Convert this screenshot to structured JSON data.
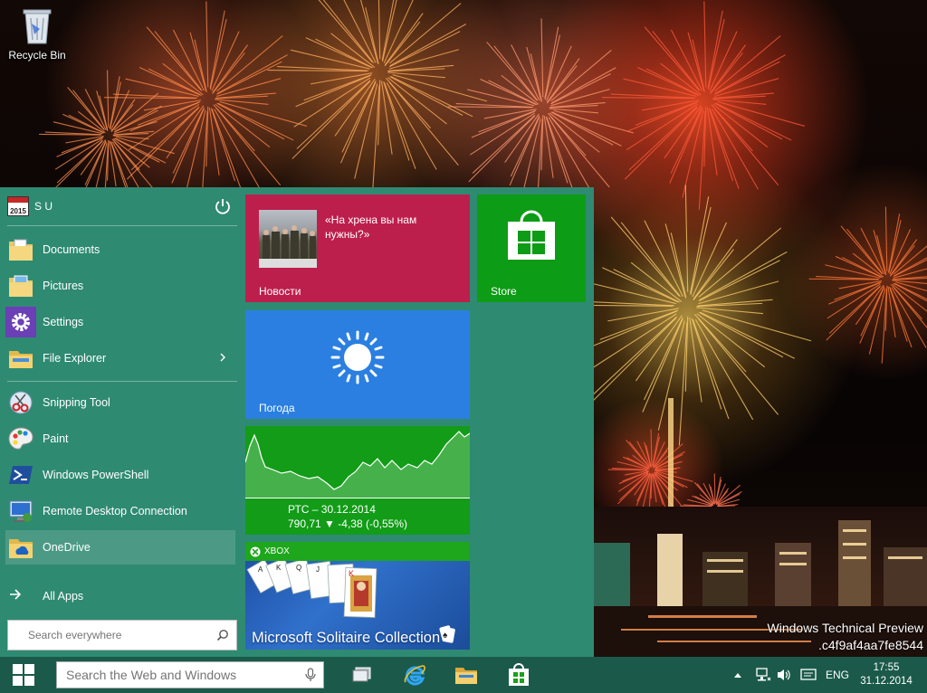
{
  "desktop": {
    "recycle_bin_label": "Recycle Bin",
    "watermark_line1": "Windows Technical Preview",
    "watermark_line2": ".c4f9af4aa7fe8544"
  },
  "start_menu": {
    "user_name": "S U",
    "user_tile_text": "2015",
    "items": [
      {
        "label": "Documents",
        "icon": "folder-documents-icon"
      },
      {
        "label": "Pictures",
        "icon": "folder-pictures-icon"
      },
      {
        "label": "Settings",
        "icon": "gear-icon"
      },
      {
        "label": "File Explorer",
        "icon": "file-explorer-icon"
      },
      {
        "label": "Snipping Tool",
        "icon": "scissors-icon"
      },
      {
        "label": "Paint",
        "icon": "palette-icon"
      },
      {
        "label": "Windows PowerShell",
        "icon": "powershell-icon"
      },
      {
        "label": "Remote Desktop Connection",
        "icon": "remote-desktop-icon"
      },
      {
        "label": "OneDrive",
        "icon": "folder-onedrive-icon"
      }
    ],
    "all_apps_label": "All Apps",
    "search_placeholder": "Search everywhere"
  },
  "tiles": {
    "news": {
      "name": "Новости",
      "headline": "«На хрена вы нам нужны?»",
      "color": "#bd1f4c"
    },
    "store": {
      "name": "Store",
      "color": "#0d9c15"
    },
    "weather": {
      "name": "Погода",
      "color": "#2a7fe0"
    },
    "money": {
      "ticker_line1": "РТС – 30.12.2014",
      "ticker_value": "790,71",
      "ticker_change": "-4,38 (-0,55%)",
      "color": "#129c18"
    },
    "xbox_label": "XBOX",
    "solitaire_title": "Microsoft Solitaire Collection"
  },
  "taskbar": {
    "search_placeholder": "Search the Web and Windows",
    "apps": [
      "task-view-icon",
      "internet-explorer-icon",
      "file-explorer-icon",
      "store-icon"
    ],
    "language": "ENG",
    "time": "17:55",
    "date": "31.12.2014",
    "accent": "#1b5a4a"
  }
}
